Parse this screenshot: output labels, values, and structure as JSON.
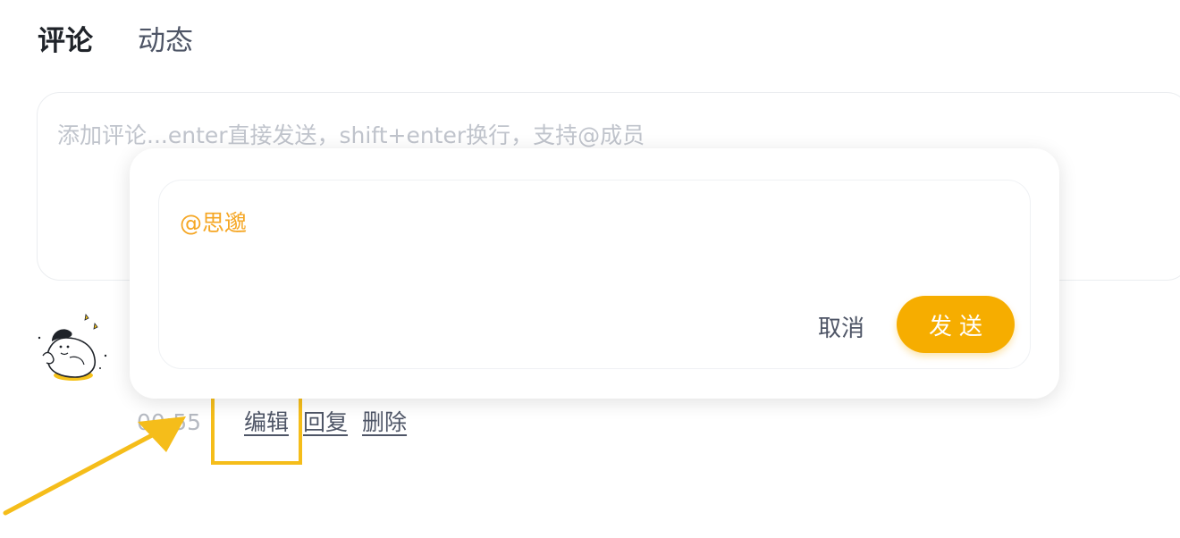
{
  "tabs": [
    {
      "label": "评论",
      "active": true
    },
    {
      "label": "动态",
      "active": false
    }
  ],
  "comment_input": {
    "placeholder": "添加评论...enter直接发送，shift+enter换行，支持@成员"
  },
  "comment": {
    "time": "00:55",
    "actions": {
      "edit": "编辑",
      "reply": "回复",
      "delete": "删除"
    }
  },
  "reply_popover": {
    "mention_text": "@思邈",
    "cancel_label": "取消",
    "send_label": "发送"
  },
  "colors": {
    "accent": "#f6ad00",
    "highlight": "#f5bd1a",
    "mention": "#f5a623"
  },
  "icons": {
    "avatar": "cartoon-avatar-icon",
    "arrow": "pointer-arrow-icon"
  }
}
